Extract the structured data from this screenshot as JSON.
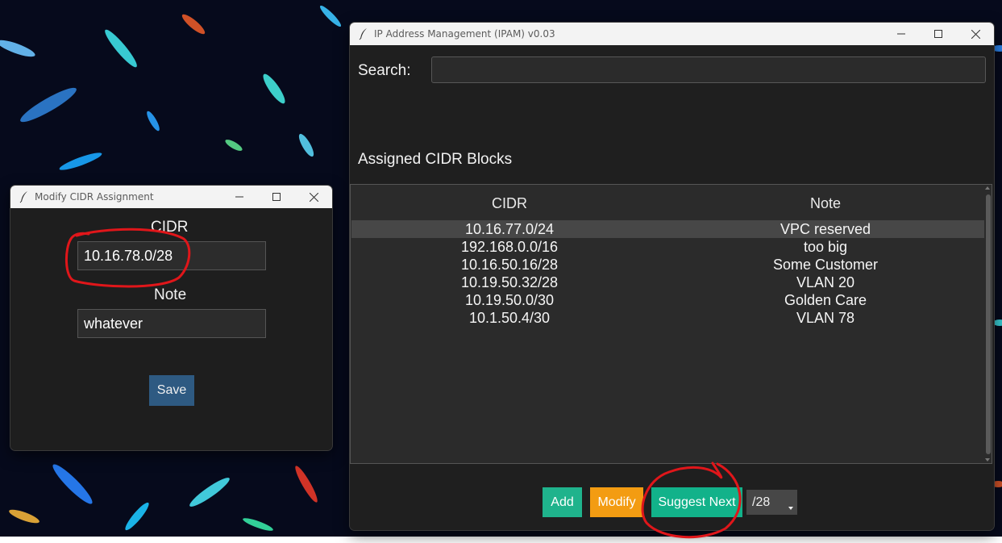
{
  "main_window": {
    "title": "IP Address Management (IPAM) v0.03",
    "search": {
      "label": "Search:",
      "value": "",
      "placeholder": ""
    },
    "section_title": "Assigned CIDR Blocks",
    "table": {
      "columns": [
        "CIDR",
        "Note"
      ],
      "rows": [
        {
          "cidr": "10.16.77.0/24",
          "note": "VPC reserved",
          "selected": true
        },
        {
          "cidr": "192.168.0.0/16",
          "note": "too big"
        },
        {
          "cidr": "10.16.50.16/28",
          "note": "Some Customer"
        },
        {
          "cidr": "10.19.50.32/28",
          "note": "VLAN 20"
        },
        {
          "cidr": "10.19.50.0/30",
          "note": "Golden Care"
        },
        {
          "cidr": "10.1.50.4/30",
          "note": "VLAN 78"
        }
      ]
    },
    "buttons": {
      "add": "Add",
      "modify": "Modify",
      "suggest_next": "Suggest Next"
    },
    "prefix_select": {
      "selected": "/28"
    }
  },
  "modify_window": {
    "title": "Modify CIDR Assignment",
    "cidr_label": "CIDR",
    "cidr_value": "10.16.78.0/28",
    "note_label": "Note",
    "note_value": "whatever",
    "save_label": "Save"
  },
  "colors": {
    "add_button": "#1fb38c",
    "modify_button": "#f39c12",
    "suggest_button": "#12b28a",
    "save_button": "#2e5a82",
    "annotation_red": "#e0161a"
  },
  "icons": [
    "feather-icon",
    "minimize-icon",
    "maximize-icon",
    "close-icon",
    "dropdown-arrow-icon"
  ]
}
